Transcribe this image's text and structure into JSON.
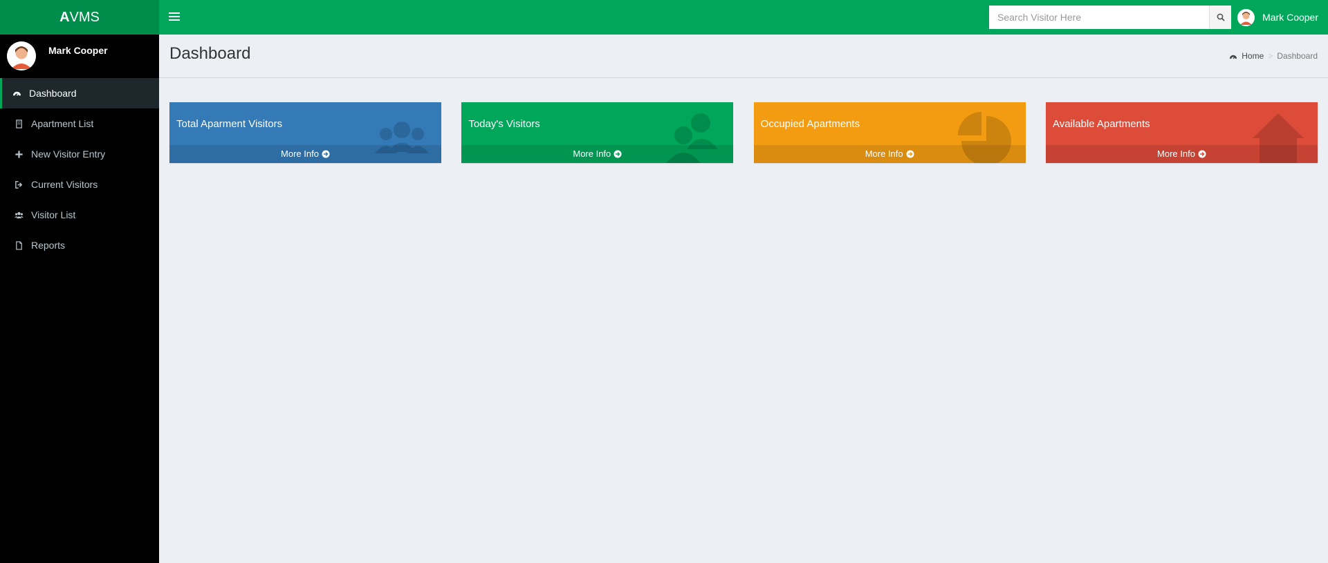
{
  "app": {
    "logo_bold": "A",
    "logo_rest": "VMS"
  },
  "search": {
    "placeholder": "Search Visitor Here"
  },
  "user": {
    "name": "Mark Cooper"
  },
  "sidebar": {
    "items": [
      {
        "label": "Dashboard",
        "icon": "dashboard-icon",
        "active": true
      },
      {
        "label": "Apartment List",
        "icon": "building-icon"
      },
      {
        "label": "New Visitor Entry",
        "icon": "plus-icon"
      },
      {
        "label": "Current Visitors",
        "icon": "sign-out-icon"
      },
      {
        "label": "Visitor List",
        "icon": "users-icon"
      },
      {
        "label": "Reports",
        "icon": "file-icon"
      }
    ]
  },
  "page": {
    "title": "Dashboard"
  },
  "breadcrumb": {
    "home": "Home",
    "current": "Dashboard"
  },
  "boxes": [
    {
      "title": "Total Aparment Visitors",
      "link": "More Info",
      "color": "#337ab7",
      "icon": "users-icon"
    },
    {
      "title": "Today's Visitors",
      "link": "More Info",
      "color": "#00a65a",
      "icon": "users-icon"
    },
    {
      "title": "Occupied Apartments",
      "link": "More Info",
      "color": "#f39c12",
      "icon": "pie-chart-icon"
    },
    {
      "title": "Available Apartments",
      "link": "More Info",
      "color": "#dd4b39",
      "icon": "home-icon"
    }
  ],
  "colors": {
    "header": "#00a65a",
    "logo_bg": "#008d4c",
    "sidebar_bg": "#000000",
    "content_bg": "#ecf0f5"
  }
}
